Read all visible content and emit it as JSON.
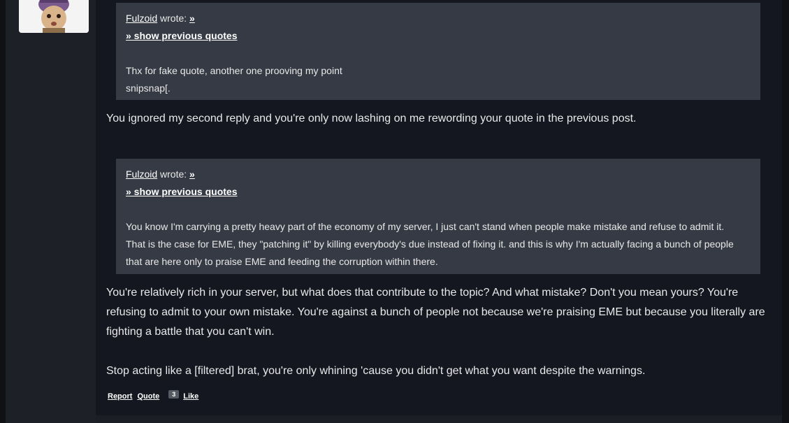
{
  "quote1": {
    "author": "Fulzoid",
    "wrote": "wrote:",
    "goto": "»",
    "show_previous": "» show previous quotes",
    "lines": [
      "Thx for fake quote, another one prooving my point",
      "snipsnap[."
    ]
  },
  "reply1": "You ignored my second reply and you're only now lashing on me rewording your quote in the previous post.",
  "quote2": {
    "author": "Fulzoid",
    "wrote": "wrote:",
    "goto": "»",
    "show_previous": "» show previous quotes",
    "lines": [
      "You know I'm carrying a pretty heavy part of the economy of my server, I just can't stand when people make mistake and refuse to admit it.",
      "That is the case for EME, they \"patching it\" by killing everybody's due instead of fixing it. and this is why I'm actually facing a bunch of people",
      "that are here only to praise EME and feeding the corruption within there."
    ]
  },
  "reply2": [
    "You're relatively rich in your server, but what does that contribute to the topic? And what mistake? Don't you mean yours? You're",
    "refusing to admit to your own mistake. You're against a bunch of people not because we're praising EME but because you literally are",
    "fighting a battle that you can't win."
  ],
  "reply3": "Stop acting like a [filtered] brat, you're only whining 'cause you didn't get what you want despite the warnings.",
  "footer": {
    "report": "Report",
    "quote": "Quote",
    "like_count": "3",
    "like": "Like"
  }
}
